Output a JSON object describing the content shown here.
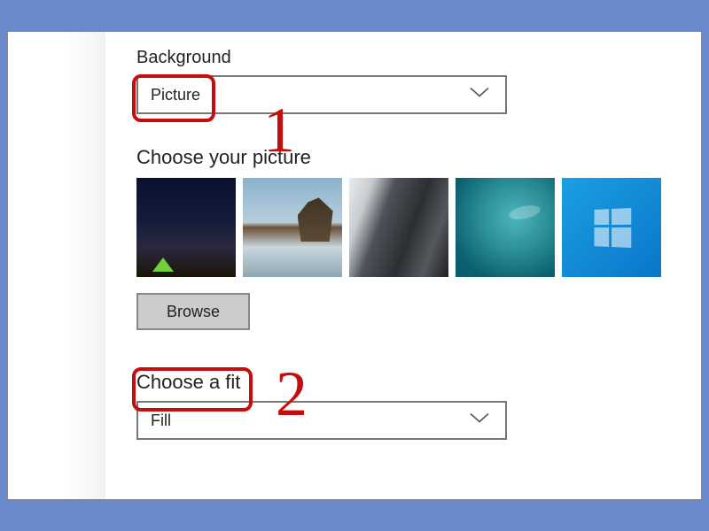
{
  "background": {
    "label": "Background",
    "dropdown_value": "Picture"
  },
  "choose_picture": {
    "label": "Choose your picture",
    "browse_label": "Browse",
    "thumbnails": [
      {
        "name": "night-tent"
      },
      {
        "name": "beach-rock"
      },
      {
        "name": "grey-cliff"
      },
      {
        "name": "underwater"
      },
      {
        "name": "windows-default"
      }
    ]
  },
  "choose_fit": {
    "label": "Choose a fit",
    "dropdown_value": "Fill"
  },
  "annotations": {
    "marker1": "1",
    "marker2": "2",
    "highlight_color": "#c40e0e"
  }
}
